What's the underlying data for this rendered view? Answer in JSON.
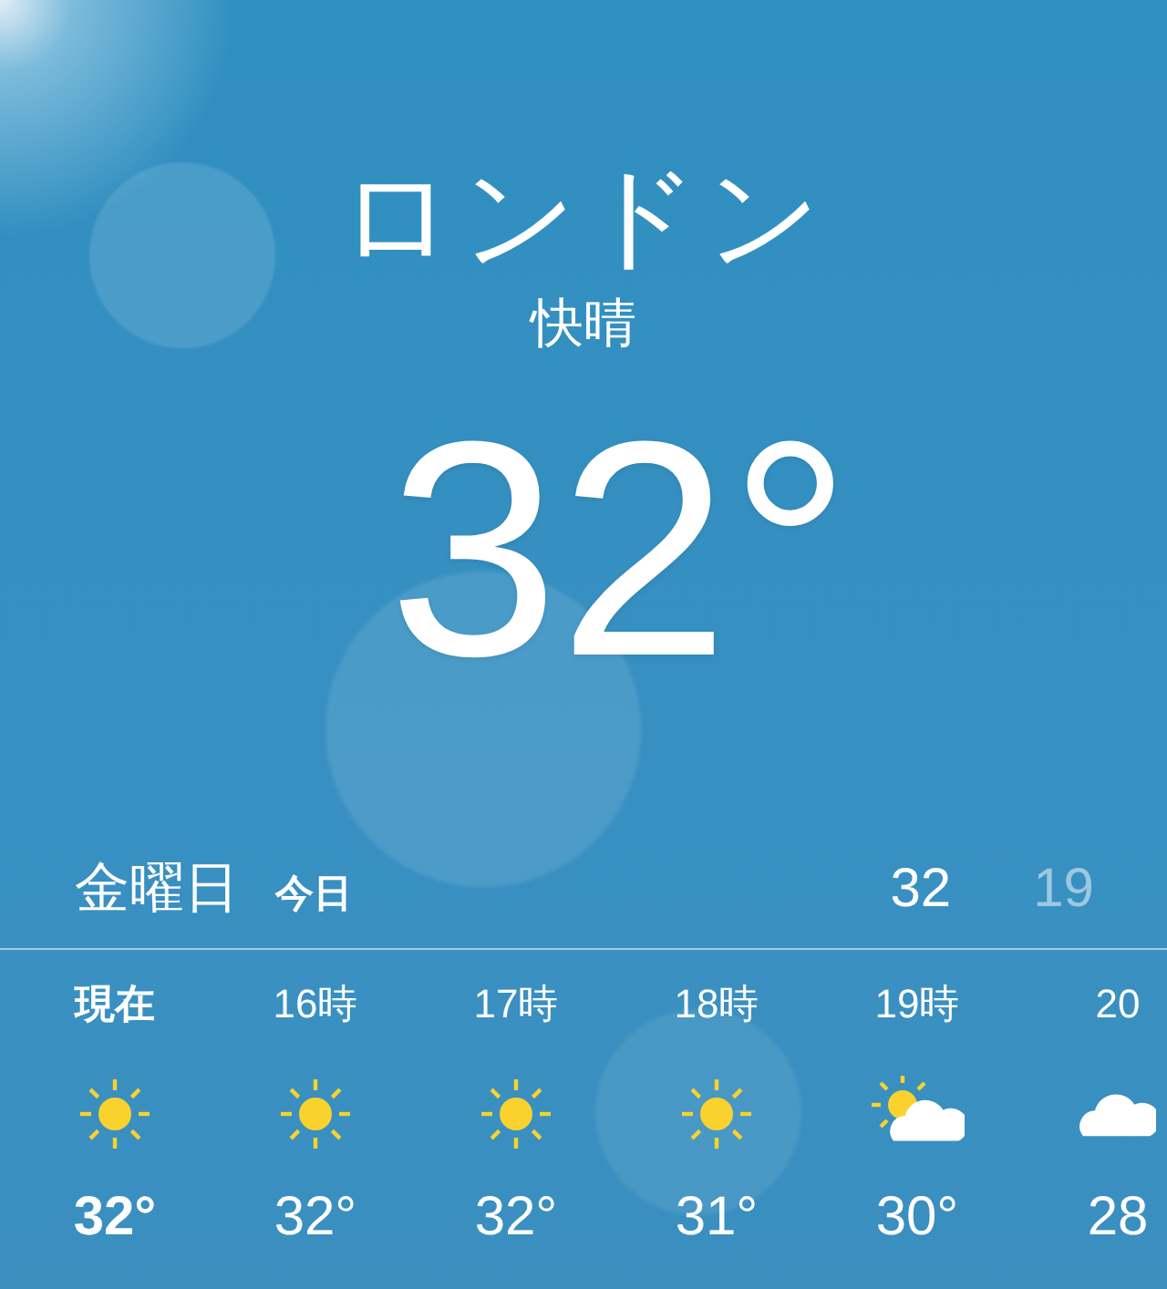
{
  "location": {
    "city": "ロンドン",
    "condition": "快晴",
    "temperature": "32°"
  },
  "today": {
    "day": "金曜日",
    "label": "今日",
    "high": "32",
    "low": "19"
  },
  "hourly": [
    {
      "time": "現在",
      "kind": "sun",
      "temp": "32°",
      "current": true
    },
    {
      "time": "16時",
      "kind": "sun",
      "temp": "32°",
      "current": false
    },
    {
      "time": "17時",
      "kind": "sun",
      "temp": "32°",
      "current": false
    },
    {
      "time": "18時",
      "kind": "sun",
      "temp": "31°",
      "current": false
    },
    {
      "time": "19時",
      "kind": "partly-cloudy",
      "temp": "30°",
      "current": false
    },
    {
      "time": "20",
      "kind": "cloud",
      "temp": "28",
      "current": false
    }
  ]
}
